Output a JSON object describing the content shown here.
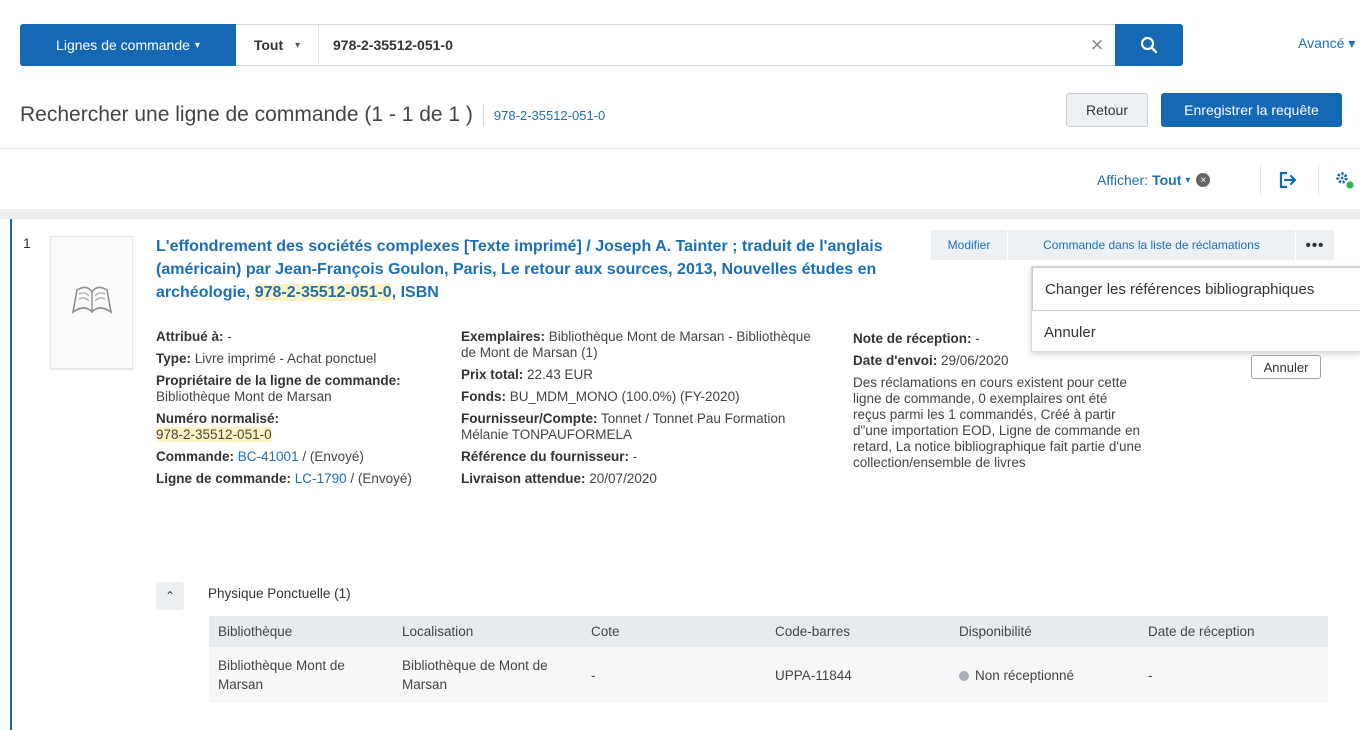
{
  "search": {
    "scope_label": "Lignes de commande",
    "scope_caret": "▾",
    "filter_label": "Tout",
    "filter_caret": "▾",
    "query": "978-2-35512-051-0",
    "clear_icon": "×",
    "advanced_label": "Avancé ▾"
  },
  "header": {
    "title": "Rechercher une ligne de commande (1 - 1 de 1 )",
    "query_link": "978-2-35512-051-0",
    "back_label": "Retour",
    "save_query_label": "Enregistrer la requête"
  },
  "toolbar": {
    "show_label": "Afficher:",
    "show_value": "Tout",
    "show_caret": "▾",
    "clear_icon": "×"
  },
  "result": {
    "index": "1",
    "title_part1": "L'effondrement des sociétés complexes [Texte imprimé] / Joseph A. Tainter ; traduit de l'anglais (américain) par Jean-François Goulon, Paris, Le retour aux sources, 2013, Nouvelles études en archéologie, ",
    "title_isbn": "978-2-35512-051-0",
    "title_part2": ", ISBN",
    "actions": {
      "modify": "Modifier",
      "claim": "Commande dans la liste de réclamations",
      "more": "•••"
    },
    "menu": {
      "change_biblio": "Changer les références bibliographiques",
      "cancel": "Annuler"
    },
    "cancel_button": "Annuler",
    "col1": {
      "assigned_label": "Attribué à:",
      "assigned_value": " -",
      "type_label": "Type:",
      "type_value": " Livre imprimé - Achat ponctuel",
      "owner_label": "Propriétaire de la ligne de commande:",
      "owner_value": " Bibliothèque Mont de Marsan",
      "std_label": "Numéro normalisé:",
      "std_value": "978-2-35512-051-0",
      "order_label": "Commande:",
      "order_link": "BC-41001",
      "order_status": " / (Envoyé)",
      "line_label": "Ligne de commande:",
      "line_link": "LC-1790",
      "line_status": " / (Envoyé)"
    },
    "col2": {
      "copies_label": "Exemplaires:",
      "copies_value": " Bibliothèque Mont de Marsan - Bibliothèque de Mont de Marsan (1)",
      "price_label": "Prix total:",
      "price_value": " 22.43 EUR",
      "fund_label": "Fonds:",
      "fund_value": " BU_MDM_MONO (100.0%) (FY-2020)",
      "vendor_label": "Fournisseur/Compte:",
      "vendor_value": " Tonnet / Tonnet Pau Formation Mélanie TONPAUFORMELA",
      "vendor_ref_label": "Référence du fournisseur:",
      "vendor_ref_value": " -",
      "delivery_label": "Livraison attendue:",
      "delivery_value": " 20/07/2020"
    },
    "col3": {
      "receipt_note_label": "Note de réception:",
      "receipt_note_value": " -",
      "sent_label": "Date d'envoi:",
      "sent_value": " 29/06/2020",
      "alerts": "Des réclamations en cours existent pour cette ligne de commande, 0 exemplaires ont été reçus parmi les 1 commandés, Créé à partir d\"une importation EOD, Ligne de commande en retard, La notice bibliographique fait partie d'une collection/ensemble de livres"
    },
    "physical": {
      "collapse_icon": "⌃",
      "label": "Physique Ponctuelle (1)",
      "headers": [
        "Bibliothèque",
        "Localisation",
        "Cote",
        "Code-barres",
        "Disponibilité",
        "Date de réception"
      ],
      "rows": [
        [
          "Bibliothèque Mont de Marsan",
          "Bibliothèque de Mont de Marsan",
          "-",
          "UPPA-11844",
          "Non réceptionné",
          "-"
        ]
      ]
    }
  },
  "colors": {
    "primary": "#1568b3",
    "link": "#1a6fb5",
    "highlight": "#fff3c4",
    "status_dot": "#aab0b6",
    "gear_accent": "#35b34a"
  }
}
